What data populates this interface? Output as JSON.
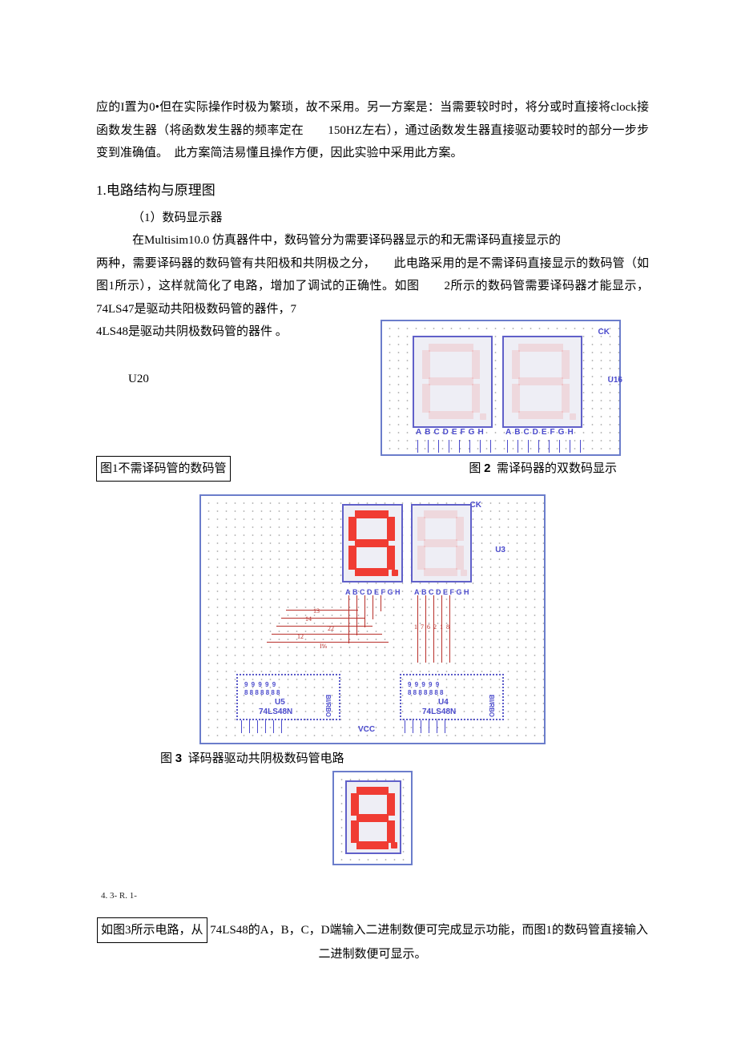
{
  "para1": "应的I置为0•但在实际操作时极为繁琐，故不采用。另一方案是：当需要较时时，将分或时直接将clock接函数发生器（将函数发生器的频率定在　　150HZ左右），通过函数发生器直接驱动要较时的部分一步步变到准确值。　此方案简洁易懂且操作方便，因此实验中采用此方案。",
  "sec1": {
    "title": "1.电路结构与原理图",
    "sub1": "（1）数码显示器"
  },
  "para2a": "在Multisim10.0 仿真器件中，数码管分为需要译码器显示的和无需译码直接显示的",
  "para2b": "两种，需要译码器的数码管有共阳极和共阴极之分，　　此电路采用的是不需译码直接显示的数码管（如图1所示），这样就简化了电路，增加了调试的正确性。如图　　2所示的数码管需要译码器才能显示，74LS47是驱动共阳极数码管的器件，7",
  "para2c": "4LS48是驱动共阴极数码管的器件 。",
  "labels": {
    "u20": "U20",
    "cap1": "图1不需译码管的数码管",
    "cap2_pre": "图",
    "cap2_num": "2",
    "cap2_txt": "需译码器的双数码显示",
    "cap3_pre": "图",
    "cap3_num": "3",
    "cap3_txt": "译码器驱动共阴极数码管电路",
    "ck": "CK",
    "u16": "U16",
    "u3": "U3",
    "u5": "U5",
    "u4": "U4",
    "chip": "74LS48N",
    "vcc": "VCC",
    "pinrow": "ABCDEFGH",
    "w13": "13",
    "w14": "14",
    "w12": "12",
    "w22": "22",
    "wIpct": "I%",
    "w176218": "1 7 6 2 1 8"
  },
  "footnote": "4. 3- R. 1-",
  "para3_box": "如图3所示电路，从",
  "para3_rest": " 74LS48的A，B，C，D端输入二进制数便可完成显示功能，而图1的数码管直接输入二进制数便可显示。"
}
